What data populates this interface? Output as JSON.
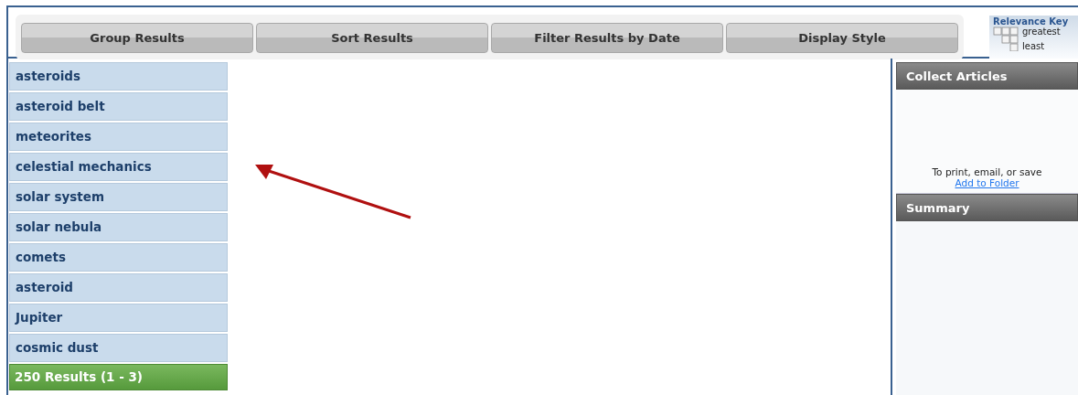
{
  "toolbar": {
    "buttons": [
      "Group Results",
      "Sort Results",
      "Filter Results by Date",
      "Display Style"
    ]
  },
  "relevance_key": {
    "title": "Relevance Key",
    "greatest": "greatest",
    "least": "least"
  },
  "groups": [
    "asteroids",
    "asteroid belt",
    "meteorites",
    "celestial mechanics",
    "solar system",
    "solar nebula",
    "comets",
    "asteroid",
    "Jupiter",
    "cosmic dust"
  ],
  "results": "250 Results (1 - 3)",
  "collect_articles": {
    "title": "Collect Articles",
    "hint": "To print, email, or save",
    "link": "Add to Folder"
  },
  "summary": {
    "title": "Summary"
  }
}
